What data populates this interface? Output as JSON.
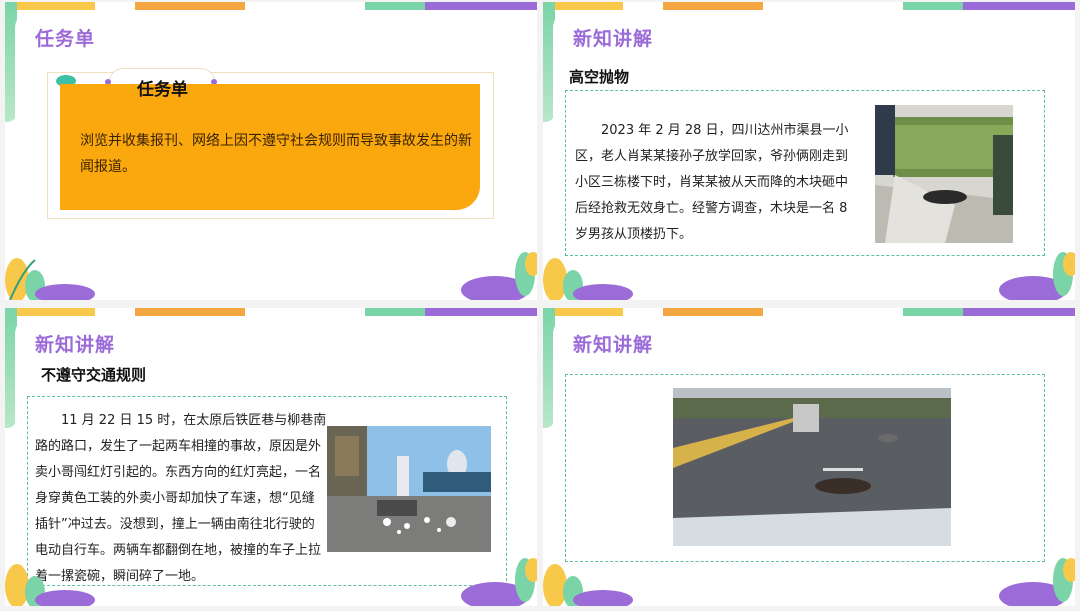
{
  "slides": [
    {
      "heading": "任务单",
      "card_title": "任务单",
      "card_text": "浏览并收集报刊、网络上因不遵守社会规则而导致事故发生的新闻报道。"
    },
    {
      "heading": "新知讲解",
      "subheading": "高空抛物",
      "body": "2023 年 2 月 28 日，四川达州市渠县一小区，老人肖某某接孙子放学回家，爷孙俩刚走到小区三栋楼下时，肖某某被从天而降的木块砸中后经抢救无效身亡。经警方调查，木块是一名 8 岁男孩从顶楼扔下。"
    },
    {
      "heading": "新知讲解",
      "subheading": "不遵守交通规则",
      "body": "11 月 22 日 15 时，在太原后铁匠巷与柳巷南路的路口，发生了一起两车相撞的事故，原因是外卖小哥闯红灯引起的。东西方向的红灯亮起，一名身穿黄色工装的外卖小哥却加快了车速，想“见缝插针”冲过去。没想到，撞上一辆由南往北行驶的电动自行车。两辆车都翻倒在地，被撞的车子上拉着一摞瓷碗，瞬间碎了一地。"
    },
    {
      "heading": "新知讲解"
    }
  ],
  "colors": {
    "heading": "#9b6bd8",
    "card": "#fba80f",
    "dash": "#5cc0a0"
  }
}
